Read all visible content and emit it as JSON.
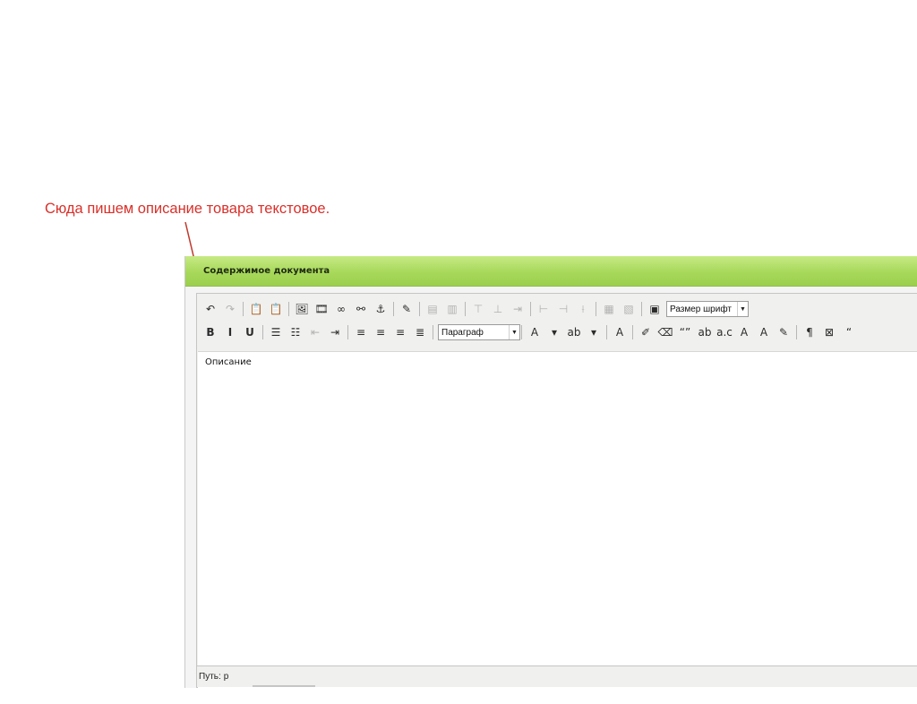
{
  "annotation": {
    "text": "Сюда пишем описание товара текстовое.",
    "color": "#d9302a"
  },
  "panel": {
    "title": "Содержимое документа",
    "header_color": "#a7d85a"
  },
  "toolbar": {
    "row1": [
      {
        "icon": "undo-icon",
        "glyph": "↶"
      },
      {
        "icon": "redo-icon",
        "glyph": "↷",
        "disabled": true
      },
      {
        "separator": true
      },
      {
        "icon": "paste-as-text-icon",
        "glyph": "📋"
      },
      {
        "icon": "paste-from-word-icon",
        "glyph": "📋"
      },
      {
        "separator": true
      },
      {
        "icon": "insert-image-icon",
        "glyph": "🖼"
      },
      {
        "icon": "insert-media-icon",
        "glyph": "🎞"
      },
      {
        "icon": "insert-link-icon",
        "glyph": "∞"
      },
      {
        "icon": "unlink-icon",
        "glyph": "⚯"
      },
      {
        "icon": "anchor-icon",
        "glyph": "⚓"
      },
      {
        "separator": true
      },
      {
        "icon": "edit-html-icon",
        "glyph": "✎"
      },
      {
        "separator": true
      },
      {
        "icon": "insert-table-icon",
        "glyph": "▤",
        "disabled": true
      },
      {
        "icon": "table-props-icon",
        "glyph": "▥",
        "disabled": true
      },
      {
        "separator": true
      },
      {
        "icon": "row-before-icon",
        "glyph": "⊤",
        "disabled": true
      },
      {
        "icon": "row-after-icon",
        "glyph": "⊥",
        "disabled": true
      },
      {
        "icon": "delete-row-icon",
        "glyph": "⇥",
        "disabled": true
      },
      {
        "separator": true
      },
      {
        "icon": "col-before-icon",
        "glyph": "⊢",
        "disabled": true
      },
      {
        "icon": "col-after-icon",
        "glyph": "⊣",
        "disabled": true
      },
      {
        "icon": "delete-col-icon",
        "glyph": "⟊",
        "disabled": true
      },
      {
        "separator": true
      },
      {
        "icon": "merge-cells-icon",
        "glyph": "▦",
        "disabled": true
      },
      {
        "icon": "split-cells-icon",
        "glyph": "▧",
        "disabled": true
      },
      {
        "separator": true
      },
      {
        "icon": "fullscreen-icon",
        "glyph": "▣"
      }
    ],
    "font_size_select": "Размер шрифт",
    "row2_left": [
      {
        "icon": "bold-icon",
        "glyph": "B",
        "bold": true
      },
      {
        "icon": "italic-icon",
        "glyph": "I",
        "bold": true
      },
      {
        "icon": "underline-icon",
        "glyph": "U",
        "bold": true
      },
      {
        "separator": true
      },
      {
        "icon": "bullet-list-icon",
        "glyph": "☰"
      },
      {
        "icon": "numbered-list-icon",
        "glyph": "☷"
      },
      {
        "icon": "outdent-icon",
        "glyph": "⇤",
        "disabled": true
      },
      {
        "icon": "indent-icon",
        "glyph": "⇥"
      },
      {
        "separator": true
      },
      {
        "icon": "align-left-icon",
        "glyph": "≡"
      },
      {
        "icon": "align-center-icon",
        "glyph": "≡"
      },
      {
        "icon": "align-right-icon",
        "glyph": "≡"
      },
      {
        "icon": "align-justify-icon",
        "glyph": "≣"
      },
      {
        "separator": true
      }
    ],
    "format_select": "Параграф",
    "row2_right": [
      {
        "separator": true
      },
      {
        "icon": "text-color-icon",
        "glyph": "A"
      },
      {
        "icon": "text-color-dropdown-icon",
        "glyph": "▾"
      },
      {
        "icon": "highlight-color-icon",
        "glyph": "ab"
      },
      {
        "icon": "highlight-dropdown-icon",
        "glyph": "▾"
      },
      {
        "separator": true
      },
      {
        "icon": "styles-icon",
        "glyph": "A"
      },
      {
        "separator": true
      },
      {
        "icon": "cleanup-icon",
        "glyph": "✐"
      },
      {
        "icon": "remove-format-icon",
        "glyph": "⌫"
      },
      {
        "icon": "quote-icon",
        "glyph": "“”"
      },
      {
        "icon": "abbr-icon",
        "glyph": "ab"
      },
      {
        "icon": "acronym-icon",
        "glyph": "a.c"
      },
      {
        "icon": "strikethrough-icon",
        "glyph": "A"
      },
      {
        "icon": "insert-text-icon",
        "glyph": "A"
      },
      {
        "icon": "attributes-icon",
        "glyph": "✎"
      },
      {
        "separator": true
      },
      {
        "icon": "show-blocks-icon",
        "glyph": "¶"
      },
      {
        "icon": "nonbreaking-icon",
        "glyph": "⊠"
      },
      {
        "icon": "blockquote-icon",
        "glyph": "“"
      }
    ]
  },
  "content": {
    "text": "Описание"
  },
  "status": {
    "path_label": "Путь:",
    "path_value": "p"
  }
}
